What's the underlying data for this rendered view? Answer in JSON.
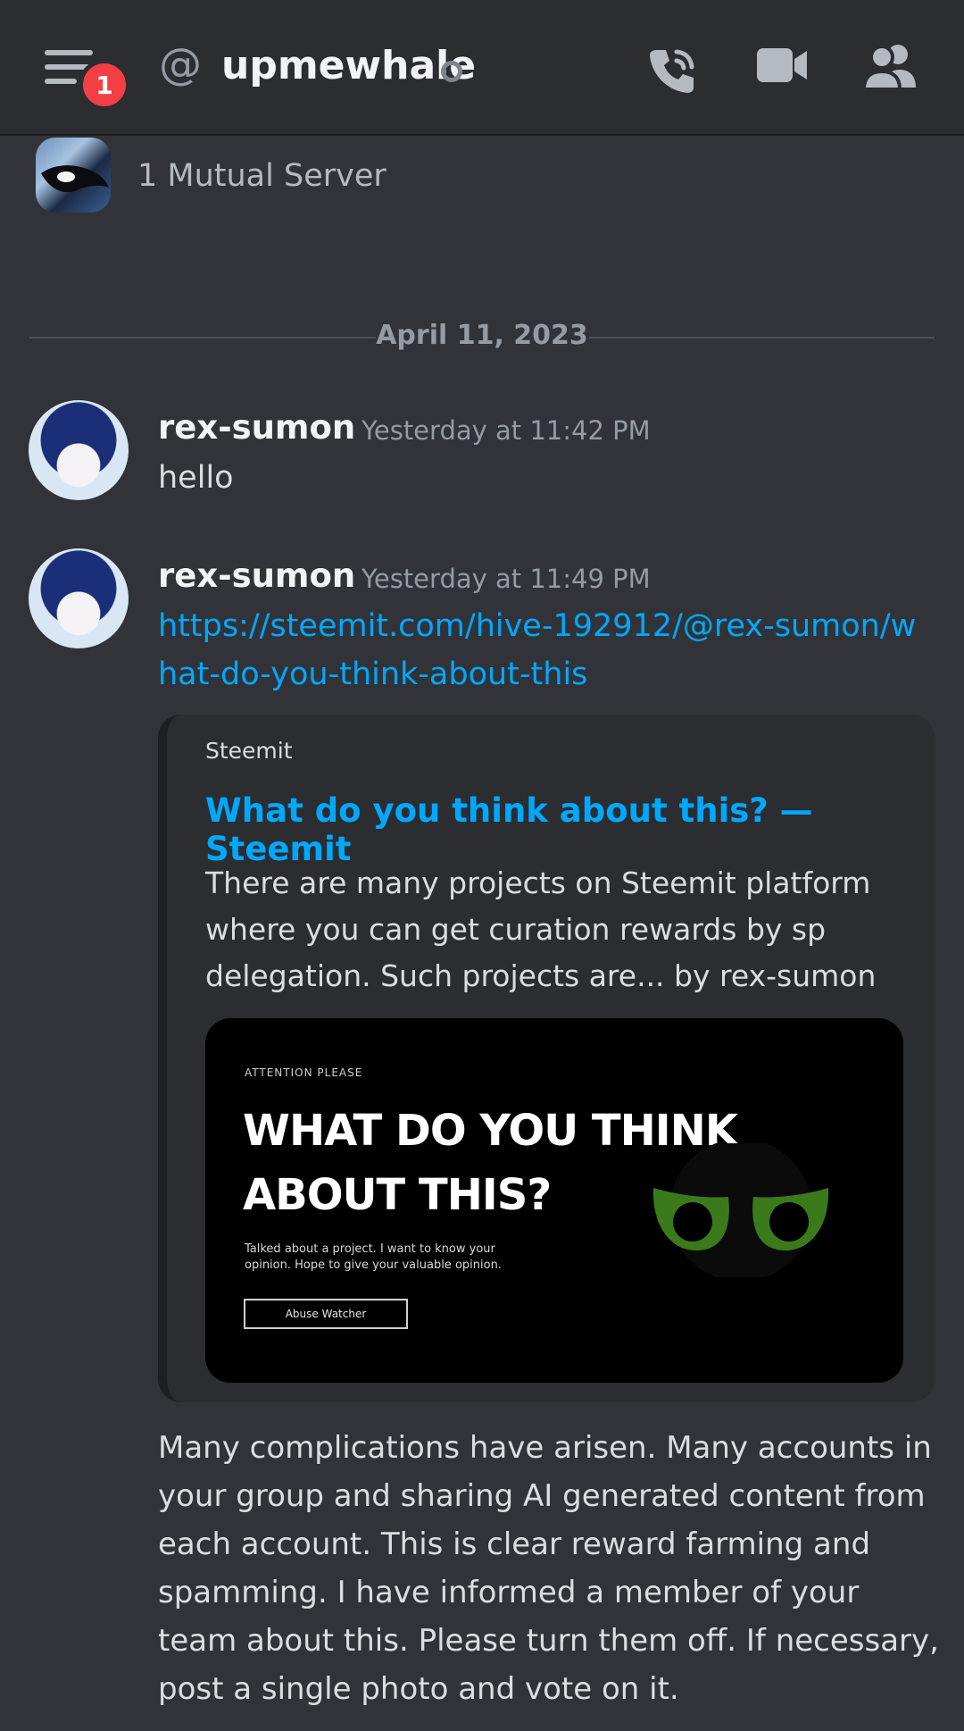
{
  "header": {
    "notification_count": "1",
    "at_symbol": "@",
    "channel_name": "upmewhale",
    "icons": [
      "menu-icon",
      "at-icon",
      "phone-call-icon",
      "video-camera-icon",
      "members-icon"
    ]
  },
  "profile": {
    "mutual_servers": "1 Mutual Server"
  },
  "date_divider": "April 11, 2023",
  "messages": [
    {
      "username": "rex-sumon",
      "timestamp": "Yesterday at 11:42 PM",
      "text": "hello"
    },
    {
      "username": "rex-sumon",
      "timestamp": "Yesterday at 11:49 PM",
      "link": "https://steemit.com/hive-192912/@rex-sumon/what-do-you-think-about-this",
      "embed": {
        "provider": "Steemit",
        "title": "What do you think about this? — Steemit",
        "description": "There are many projects on Steemit platform where you can get curation rewards by sp delegation.  Such projects are... by rex-sumon",
        "image": {
          "kicker": "ATTENTION PLEASE",
          "headline_line1": "WHAT DO YOU THINK",
          "headline_line2": "ABOUT THIS?",
          "subtext": "Talked about a project.  I want to know your opinion.  Hope to give your valuable opinion.",
          "button": "Abuse Watcher"
        }
      },
      "text": "Many complications have arisen.  Many accounts in your group and sharing AI generated content from each account.  This is clear reward farming and spamming.  I have informed a member of your team about this.  Please turn them off.  If necessary, post a single photo and vote on it."
    }
  ],
  "colors": {
    "background": "#313338",
    "header": "#2b2d31",
    "link": "#00a8fc",
    "badge": "#f23f43"
  }
}
